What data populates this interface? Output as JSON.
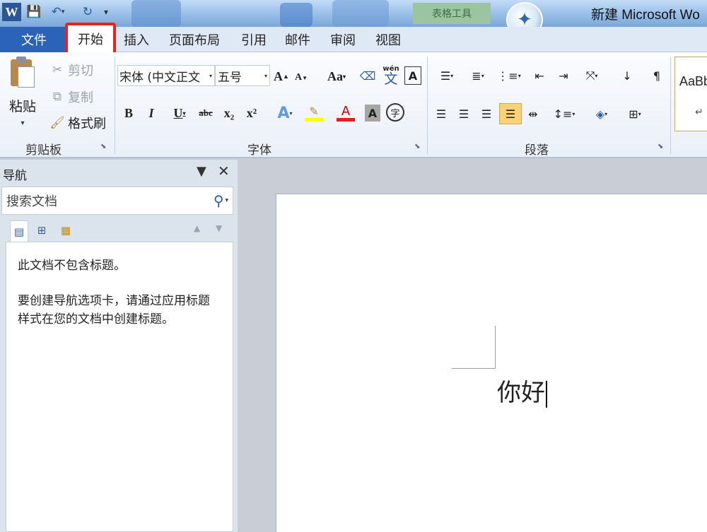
{
  "title_bar": {
    "app_icon_letter": "W",
    "contextual_tab": "表格工具",
    "window_title": "新建 Microsoft Wo"
  },
  "tabs": [
    "文件",
    "开始",
    "插入",
    "页面布局",
    "引用",
    "邮件",
    "审阅",
    "视图"
  ],
  "active_tab": "开始",
  "highlight_color": "#e8231a",
  "clipboard": {
    "paste": "粘贴",
    "cut": "剪切",
    "copy": "复制",
    "format_painter": "格式刷",
    "group": "剪贴板"
  },
  "font": {
    "name": "宋体 (中文正文",
    "size": "五号",
    "group": "字体",
    "bold": "B",
    "italic": "I",
    "underline": "U",
    "strike": "abc",
    "sub": "x₂",
    "sup": "x²",
    "grow": "A",
    "shrink": "A",
    "change_case": "Aa",
    "pinyin": "wén",
    "pinyin_char": "文",
    "border_char": "A",
    "font_color": "A",
    "shading_char": "A",
    "enclose_char": "字"
  },
  "paragraph": {
    "group": "段落"
  },
  "styles": {
    "sample": "AaBb",
    "mark": "↵"
  },
  "nav": {
    "title": "导航",
    "search_placeholder": "搜索文档",
    "msg1": "此文档不包含标题。",
    "msg2": "要创建导航选项卡，请通过应用标题样式在您的文档中创建标题。"
  },
  "document": {
    "text": "你好"
  }
}
